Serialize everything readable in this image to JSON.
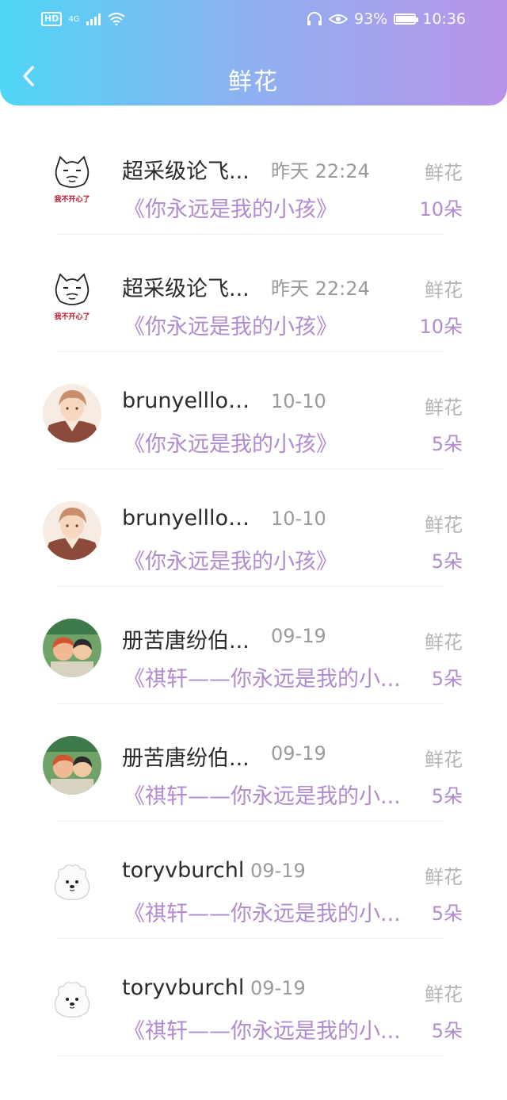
{
  "status_bar": {
    "hd": "HD",
    "network": "4G",
    "battery_percent": "93%",
    "time": "10:36",
    "battery_level": 0.93
  },
  "header": {
    "title": "鲜花",
    "back_icon": "chevron-left-icon",
    "gradient_start": "#4fd6f7",
    "gradient_end": "#b993ea"
  },
  "list": [
    {
      "name": "超采级论飞...",
      "time": "昨天 22:24",
      "book": "《你永远是我的小孩》",
      "gift": "鲜花",
      "count": "10朵",
      "avatar": "cartoon-cat",
      "avatar_text": "我不开心了"
    },
    {
      "name": "超采级论飞...",
      "time": "昨天 22:24",
      "book": "《你永远是我的小孩》",
      "gift": "鲜花",
      "count": "10朵",
      "avatar": "cartoon-cat",
      "avatar_text": "我不开心了"
    },
    {
      "name": "brunyellloc...",
      "time": "10-10",
      "book": "《你永远是我的小孩》",
      "gift": "鲜花",
      "count": "5朵",
      "avatar": "anime-boy",
      "avatar_text": ""
    },
    {
      "name": "brunyellloc...",
      "time": "10-10",
      "book": "《你永远是我的小孩》",
      "gift": "鲜花",
      "count": "5朵",
      "avatar": "anime-boy",
      "avatar_text": ""
    },
    {
      "name": "册苦唐纷伯...",
      "time": "09-19",
      "book": "《祺轩——你永远是我的小...",
      "gift": "鲜花",
      "count": "5朵",
      "avatar": "anime-kids",
      "avatar_text": ""
    },
    {
      "name": "册苦唐纷伯...",
      "time": "09-19",
      "book": "《祺轩——你永远是我的小...",
      "gift": "鲜花",
      "count": "5朵",
      "avatar": "anime-kids",
      "avatar_text": ""
    },
    {
      "name": "toryvburchl",
      "time": "09-19",
      "book": "《祺轩——你永远是我的小...",
      "gift": "鲜花",
      "count": "5朵",
      "avatar": "white-dog",
      "avatar_text": ""
    },
    {
      "name": "toryvburchl",
      "time": "09-19",
      "book": "《祺轩——你永远是我的小...",
      "gift": "鲜花",
      "count": "5朵",
      "avatar": "white-dog",
      "avatar_text": ""
    }
  ]
}
